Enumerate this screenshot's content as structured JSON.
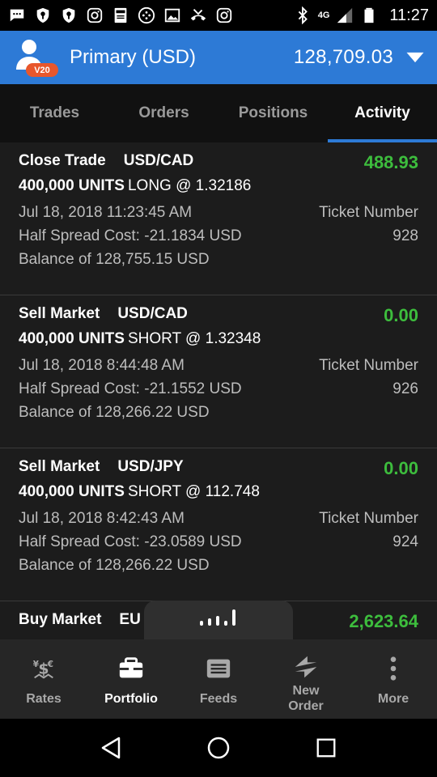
{
  "status_bar": {
    "time": "11:27",
    "network": "4G",
    "icons": [
      "message-icon",
      "shield-icon",
      "shield-icon",
      "instagram-icon",
      "bible-icon",
      "game-icon",
      "image-icon",
      "missed-call-icon",
      "instagram-icon",
      "bluetooth-icon",
      "signal-icon",
      "battery-icon"
    ]
  },
  "account": {
    "badge": "V20",
    "name": "Primary (USD)",
    "balance": "128,709.03"
  },
  "tabs": [
    {
      "label": "Trades",
      "active": false
    },
    {
      "label": "Orders",
      "active": false
    },
    {
      "label": "Positions",
      "active": false
    },
    {
      "label": "Activity",
      "active": true
    }
  ],
  "activities": [
    {
      "type": "Close Trade",
      "pair": "USD/CAD",
      "amount": "488.93",
      "units": "400,000 UNITS",
      "detail": "LONG @ 1.32186",
      "date": "Jul 18, 2018 11:23:45 AM",
      "ticket_label": "Ticket Number",
      "ticket": "928",
      "spread": "Half Spread Cost: -21.1834 USD",
      "balance": "Balance of 128,755.15 USD"
    },
    {
      "type": "Sell Market",
      "pair": "USD/CAD",
      "amount": "0.00",
      "units": "400,000 UNITS",
      "detail": "SHORT @ 1.32348",
      "date": "Jul 18, 2018 8:44:48 AM",
      "ticket_label": "Ticket Number",
      "ticket": "926",
      "spread": "Half Spread Cost: -21.1552 USD",
      "balance": "Balance of 128,266.22 USD"
    },
    {
      "type": "Sell Market",
      "pair": "USD/JPY",
      "amount": "0.00",
      "units": "400,000 UNITS",
      "detail": "SHORT @ 112.748",
      "date": "Jul 18, 2018 8:42:43 AM",
      "ticket_label": "Ticket Number",
      "ticket": "924",
      "spread": "Half Spread Cost: -23.0589 USD",
      "balance": "Balance of 128,266.22 USD"
    },
    {
      "type": "Buy Market",
      "pair": "EU",
      "amount": "2,623.64"
    }
  ],
  "bottom_nav": [
    {
      "label": "Rates",
      "icon": "rates-icon",
      "active": false
    },
    {
      "label": "Portfolio",
      "icon": "briefcase-icon",
      "active": true
    },
    {
      "label": "Feeds",
      "icon": "feeds-icon",
      "active": false
    },
    {
      "label": "New Order",
      "icon": "new-order-icon",
      "active": false
    },
    {
      "label": "More",
      "icon": "more-icon",
      "active": false
    }
  ],
  "colors": {
    "accent": "#2d7ad6",
    "positive": "#3dbd3d",
    "badge": "#e8572c"
  }
}
